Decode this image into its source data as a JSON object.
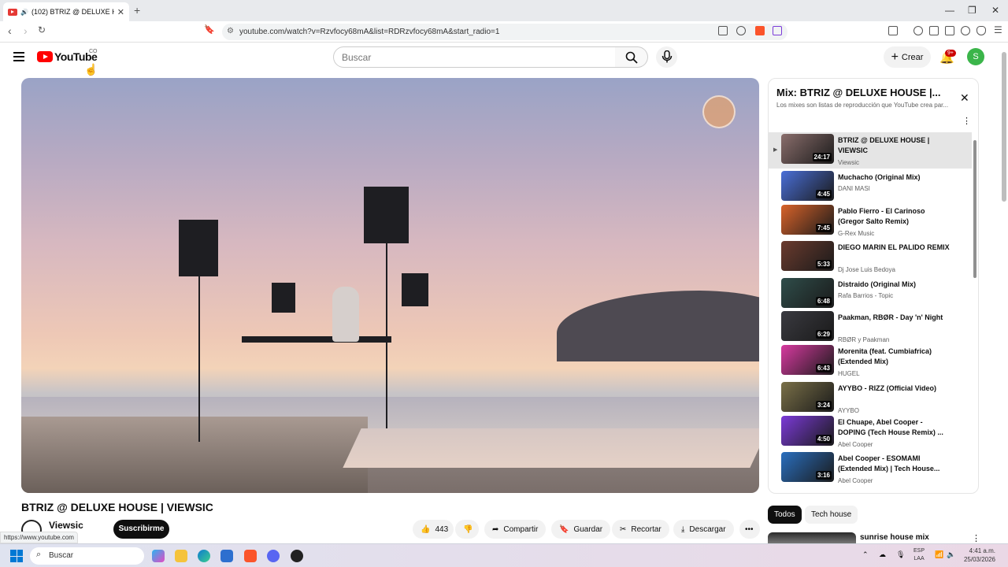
{
  "browser": {
    "tab_title": "(102) BTRIZ @ DELUXE HOUS",
    "url": "youtube.com/watch?v=Rzvfocy68mA&list=RDRzvfocy68mA&start_radio=1",
    "status_url": "https://www.youtube.com"
  },
  "header": {
    "logo_text": "YouTube",
    "country": "CO",
    "search_placeholder": "Buscar",
    "create_label": "Crear",
    "notif_badge": "9+",
    "avatar_letter": "S"
  },
  "video": {
    "title": "BTRIZ @ DELUXE HOUSE | VIEWSIC",
    "channel": "Viewsic",
    "subs_partial": "riptores",
    "subscribe_label": "Suscribirme",
    "likes": "443",
    "share_label": "Compartir",
    "save_label": "Guardar",
    "clip_label": "Recortar",
    "download_label": "Descargar"
  },
  "playlist": {
    "title": "Mix: BTRIZ @ DELUXE HOUSE |...",
    "subtitle": "Los mixes son listas de reproducción que YouTube crea par...",
    "items": [
      {
        "title": "BTRIZ @ DELUXE HOUSE | VIEWSIC",
        "channel": "Viewsic",
        "duration": "24:17",
        "color": "#8a6e6c"
      },
      {
        "title": "Muchacho (Original Mix)",
        "channel": "DANI MASI",
        "duration": "4:45",
        "color": "#4a6fd8"
      },
      {
        "title": "Pablo Fierro - El Carinoso (Gregor Salto Remix)",
        "channel": "G-Rex Music",
        "duration": "7:45",
        "color": "#d9632a"
      },
      {
        "title": "DIEGO MARIN EL PALIDO REMIX",
        "channel": "Dj Jose Luis Bedoya",
        "duration": "5:33",
        "color": "#6b3b2e"
      },
      {
        "title": "Distraido (Original Mix)",
        "channel": "Rafa Barrios - Topic",
        "duration": "6:48",
        "color": "#2f4d4a"
      },
      {
        "title": "Paakman, RBØR - Day 'n' Night",
        "channel": "RBØR y Paakman",
        "duration": "6:29",
        "color": "#3a3a40"
      },
      {
        "title": "Morenita (feat. Cumbiafrica) (Extended Mix)",
        "channel": "HUGEL",
        "duration": "6:43",
        "color": "#d83aa0"
      },
      {
        "title": "AYYBO - RIZZ (Official Video)",
        "channel": "AYYBO",
        "duration": "3:24",
        "color": "#7a7048"
      },
      {
        "title": "El Chuape, Abel Cooper - DOPING (Tech House Remix) ...",
        "channel": "Abel Cooper",
        "duration": "4:50",
        "color": "#7b3ad8"
      },
      {
        "title": "Abel Cooper - ESOMAMI (Extended Mix) | Tech House...",
        "channel": "Abel Cooper",
        "duration": "3:16",
        "color": "#2a6fbf"
      }
    ]
  },
  "chips": [
    "Todos",
    "Tech house"
  ],
  "recommended": {
    "title": "sunrise house mix"
  },
  "taskbar": {
    "search_label": "Buscar",
    "lang_top": "ESP",
    "lang_bottom": "LAA",
    "time": "4:41 a.m.",
    "date": "25/03/2026"
  }
}
